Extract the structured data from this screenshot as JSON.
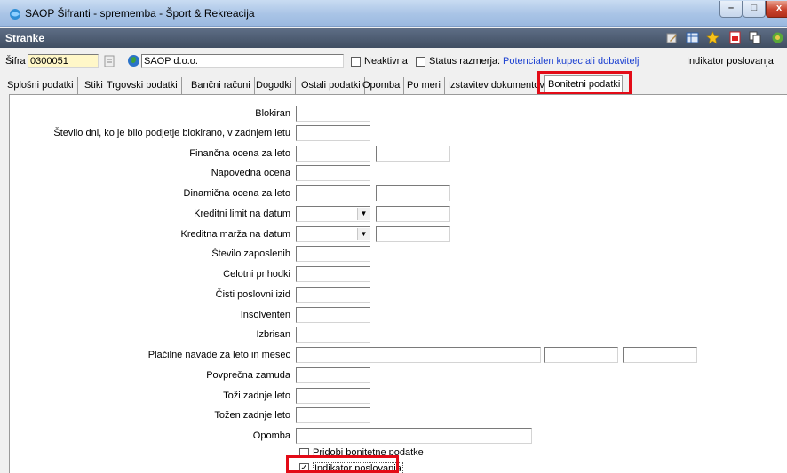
{
  "window": {
    "title": "SAOP Šifranti - sprememba - Šport & Rekreacija",
    "minimize": "–",
    "maximize": "□",
    "close": "x"
  },
  "panel": {
    "title": "Stranke"
  },
  "header_fields": {
    "sifra_label": "Šifra",
    "sifra_value": "0300051",
    "company_name": "SAOP d.o.o.",
    "neaktivna_label": "Neaktivna",
    "status_label": "Status razmerja:",
    "status_value": "Potencialen kupec ali dobavitelj",
    "indikator_label": "Indikator poslovanja"
  },
  "tabs": [
    {
      "label": "Splošni podatki"
    },
    {
      "label": "Stiki"
    },
    {
      "label": "Trgovski podatki"
    },
    {
      "label": "Bančni računi"
    },
    {
      "label": "Dogodki"
    },
    {
      "label": "Ostali podatki"
    },
    {
      "label": "Opomba"
    },
    {
      "label": "Po meri"
    },
    {
      "label": "Izstavitev dokumentov"
    },
    {
      "label": "Bonitetni podatki"
    }
  ],
  "fields": {
    "blokiran": "Blokiran",
    "stevilo_dni": "Število dni, ko je bilo podjetje blokirano, v zadnjem letu",
    "financna_ocena": "Finančna ocena za leto",
    "napovedna_ocena": "Napovedna ocena",
    "dinamicna_ocena": "Dinamična ocena za leto",
    "kreditni_limit": "Kreditni limit na datum",
    "kreditna_marza": "Kreditna marža na datum",
    "stevilo_zaposlenih": "Število zaposlenih",
    "celotni_prihodki": "Celotni prihodki",
    "cisti_izid": "Čisti poslovni izid",
    "insolventen": "Insolventen",
    "izbrisan": "Izbrisan",
    "placilne_navade": "Plačilne navade za leto in mesec",
    "povprecna_zamuda": "Povprečna zamuda",
    "tozi_zadnje_leto": "Toži zadnje leto",
    "tozen_zadnje_leto": "Tožen zadnje leto",
    "opomba": "Opomba"
  },
  "checkboxes": {
    "pridobi_label": "Pridobi bonitetne podatke",
    "indikator_label": "Indikator poslovanja",
    "check_mark": "✓"
  },
  "colors": {
    "highlight": "#e30b17",
    "status_link": "#1a3fd1",
    "panel_header": "#4a586d"
  }
}
